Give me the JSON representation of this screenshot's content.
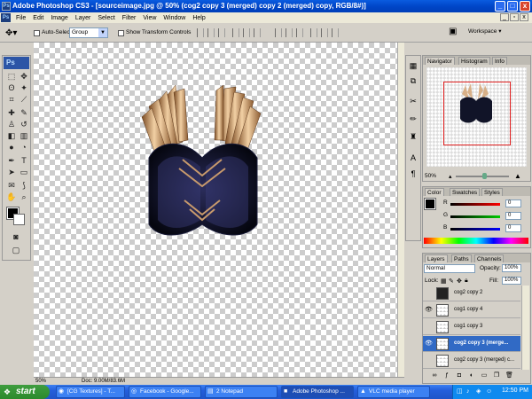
{
  "window": {
    "title": "Adobe Photoshop CS3 - [sourceimage.jpg @ 50% (cog2 copy 3 (merged) copy 2 (merged) copy, RGB/8#)]",
    "app_icon": "Ps",
    "minimize": "_",
    "maximize": "□",
    "close": "x"
  },
  "menu": {
    "items": [
      "File",
      "Edit",
      "Image",
      "Layer",
      "Select",
      "Filter",
      "View",
      "Window",
      "Help"
    ],
    "doc_minimize": "_",
    "doc_restore": "▫",
    "doc_close": "x"
  },
  "options": {
    "auto_select_label": "Auto-Select:",
    "auto_select_value": "Group",
    "show_transform_label": "Show Transform Controls",
    "workspace_label": "Workspace ▾"
  },
  "toolbox": {
    "logo": "Ps"
  },
  "canvas_status": {
    "zoom": "50%",
    "doc_size": "Doc: 9.00M/83.6M"
  },
  "navigator": {
    "tabs": [
      "Navigator",
      "Histogram",
      "Info"
    ],
    "zoom": "50%"
  },
  "color": {
    "tabs": [
      "Color",
      "Swatches",
      "Styles"
    ],
    "channels": [
      {
        "label": "R",
        "value": "0",
        "color": "#d22020"
      },
      {
        "label": "G",
        "value": "0",
        "color": "#20a020"
      },
      {
        "label": "B",
        "value": "0",
        "color": "#2030d0"
      }
    ]
  },
  "layers": {
    "tabs": [
      "Layers",
      "Paths",
      "Channels"
    ],
    "blend_mode": "Normal",
    "opacity_label": "Opacity:",
    "opacity_value": "100%",
    "lock_label": "Lock:",
    "fill_label": "Fill:",
    "fill_value": "100%",
    "items": [
      {
        "name": "cog2 copy 2",
        "visible": false,
        "selected": false
      },
      {
        "name": "cog1 copy 4",
        "visible": true,
        "selected": false
      },
      {
        "name": "cog1 copy 3",
        "visible": false,
        "selected": false
      },
      {
        "name": "cog2 copy 3 (merge...",
        "visible": true,
        "selected": true
      },
      {
        "name": "cog2 copy 3 (merged) c...",
        "visible": false,
        "selected": false
      }
    ]
  },
  "taskbar": {
    "start_label": "start",
    "items": [
      {
        "label": "[CG Textures] - T..."
      },
      {
        "label": "Facebook - Google..."
      },
      {
        "label": "2 Notepad"
      },
      {
        "label": "Adobe Photoshop ..."
      },
      {
        "label": "VLC media player"
      }
    ],
    "clock": "12:50 PM"
  }
}
